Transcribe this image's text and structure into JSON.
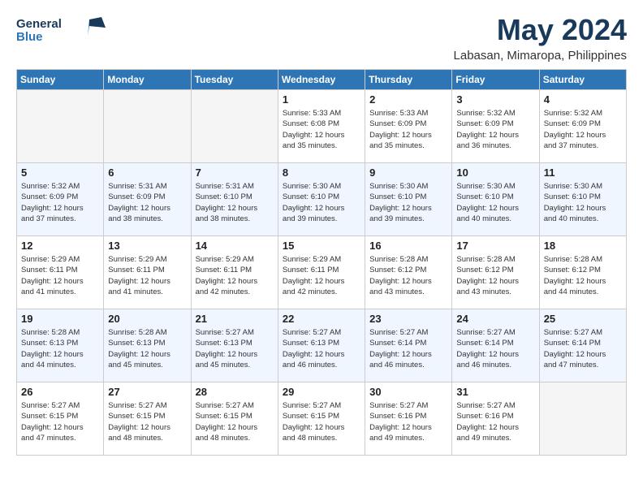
{
  "logo": {
    "line1": "General",
    "line2": "Blue"
  },
  "title": "May 2024",
  "location": "Labasan, Mimaropa, Philippines",
  "days_of_week": [
    "Sunday",
    "Monday",
    "Tuesday",
    "Wednesday",
    "Thursday",
    "Friday",
    "Saturday"
  ],
  "weeks": [
    [
      {
        "num": "",
        "info": ""
      },
      {
        "num": "",
        "info": ""
      },
      {
        "num": "",
        "info": ""
      },
      {
        "num": "1",
        "info": "Sunrise: 5:33 AM\nSunset: 6:08 PM\nDaylight: 12 hours\nand 35 minutes."
      },
      {
        "num": "2",
        "info": "Sunrise: 5:33 AM\nSunset: 6:09 PM\nDaylight: 12 hours\nand 35 minutes."
      },
      {
        "num": "3",
        "info": "Sunrise: 5:32 AM\nSunset: 6:09 PM\nDaylight: 12 hours\nand 36 minutes."
      },
      {
        "num": "4",
        "info": "Sunrise: 5:32 AM\nSunset: 6:09 PM\nDaylight: 12 hours\nand 37 minutes."
      }
    ],
    [
      {
        "num": "5",
        "info": "Sunrise: 5:32 AM\nSunset: 6:09 PM\nDaylight: 12 hours\nand 37 minutes."
      },
      {
        "num": "6",
        "info": "Sunrise: 5:31 AM\nSunset: 6:09 PM\nDaylight: 12 hours\nand 38 minutes."
      },
      {
        "num": "7",
        "info": "Sunrise: 5:31 AM\nSunset: 6:10 PM\nDaylight: 12 hours\nand 38 minutes."
      },
      {
        "num": "8",
        "info": "Sunrise: 5:30 AM\nSunset: 6:10 PM\nDaylight: 12 hours\nand 39 minutes."
      },
      {
        "num": "9",
        "info": "Sunrise: 5:30 AM\nSunset: 6:10 PM\nDaylight: 12 hours\nand 39 minutes."
      },
      {
        "num": "10",
        "info": "Sunrise: 5:30 AM\nSunset: 6:10 PM\nDaylight: 12 hours\nand 40 minutes."
      },
      {
        "num": "11",
        "info": "Sunrise: 5:30 AM\nSunset: 6:10 PM\nDaylight: 12 hours\nand 40 minutes."
      }
    ],
    [
      {
        "num": "12",
        "info": "Sunrise: 5:29 AM\nSunset: 6:11 PM\nDaylight: 12 hours\nand 41 minutes."
      },
      {
        "num": "13",
        "info": "Sunrise: 5:29 AM\nSunset: 6:11 PM\nDaylight: 12 hours\nand 41 minutes."
      },
      {
        "num": "14",
        "info": "Sunrise: 5:29 AM\nSunset: 6:11 PM\nDaylight: 12 hours\nand 42 minutes."
      },
      {
        "num": "15",
        "info": "Sunrise: 5:29 AM\nSunset: 6:11 PM\nDaylight: 12 hours\nand 42 minutes."
      },
      {
        "num": "16",
        "info": "Sunrise: 5:28 AM\nSunset: 6:12 PM\nDaylight: 12 hours\nand 43 minutes."
      },
      {
        "num": "17",
        "info": "Sunrise: 5:28 AM\nSunset: 6:12 PM\nDaylight: 12 hours\nand 43 minutes."
      },
      {
        "num": "18",
        "info": "Sunrise: 5:28 AM\nSunset: 6:12 PM\nDaylight: 12 hours\nand 44 minutes."
      }
    ],
    [
      {
        "num": "19",
        "info": "Sunrise: 5:28 AM\nSunset: 6:13 PM\nDaylight: 12 hours\nand 44 minutes."
      },
      {
        "num": "20",
        "info": "Sunrise: 5:28 AM\nSunset: 6:13 PM\nDaylight: 12 hours\nand 45 minutes."
      },
      {
        "num": "21",
        "info": "Sunrise: 5:27 AM\nSunset: 6:13 PM\nDaylight: 12 hours\nand 45 minutes."
      },
      {
        "num": "22",
        "info": "Sunrise: 5:27 AM\nSunset: 6:13 PM\nDaylight: 12 hours\nand 46 minutes."
      },
      {
        "num": "23",
        "info": "Sunrise: 5:27 AM\nSunset: 6:14 PM\nDaylight: 12 hours\nand 46 minutes."
      },
      {
        "num": "24",
        "info": "Sunrise: 5:27 AM\nSunset: 6:14 PM\nDaylight: 12 hours\nand 46 minutes."
      },
      {
        "num": "25",
        "info": "Sunrise: 5:27 AM\nSunset: 6:14 PM\nDaylight: 12 hours\nand 47 minutes."
      }
    ],
    [
      {
        "num": "26",
        "info": "Sunrise: 5:27 AM\nSunset: 6:15 PM\nDaylight: 12 hours\nand 47 minutes."
      },
      {
        "num": "27",
        "info": "Sunrise: 5:27 AM\nSunset: 6:15 PM\nDaylight: 12 hours\nand 48 minutes."
      },
      {
        "num": "28",
        "info": "Sunrise: 5:27 AM\nSunset: 6:15 PM\nDaylight: 12 hours\nand 48 minutes."
      },
      {
        "num": "29",
        "info": "Sunrise: 5:27 AM\nSunset: 6:15 PM\nDaylight: 12 hours\nand 48 minutes."
      },
      {
        "num": "30",
        "info": "Sunrise: 5:27 AM\nSunset: 6:16 PM\nDaylight: 12 hours\nand 49 minutes."
      },
      {
        "num": "31",
        "info": "Sunrise: 5:27 AM\nSunset: 6:16 PM\nDaylight: 12 hours\nand 49 minutes."
      },
      {
        "num": "",
        "info": ""
      }
    ]
  ]
}
